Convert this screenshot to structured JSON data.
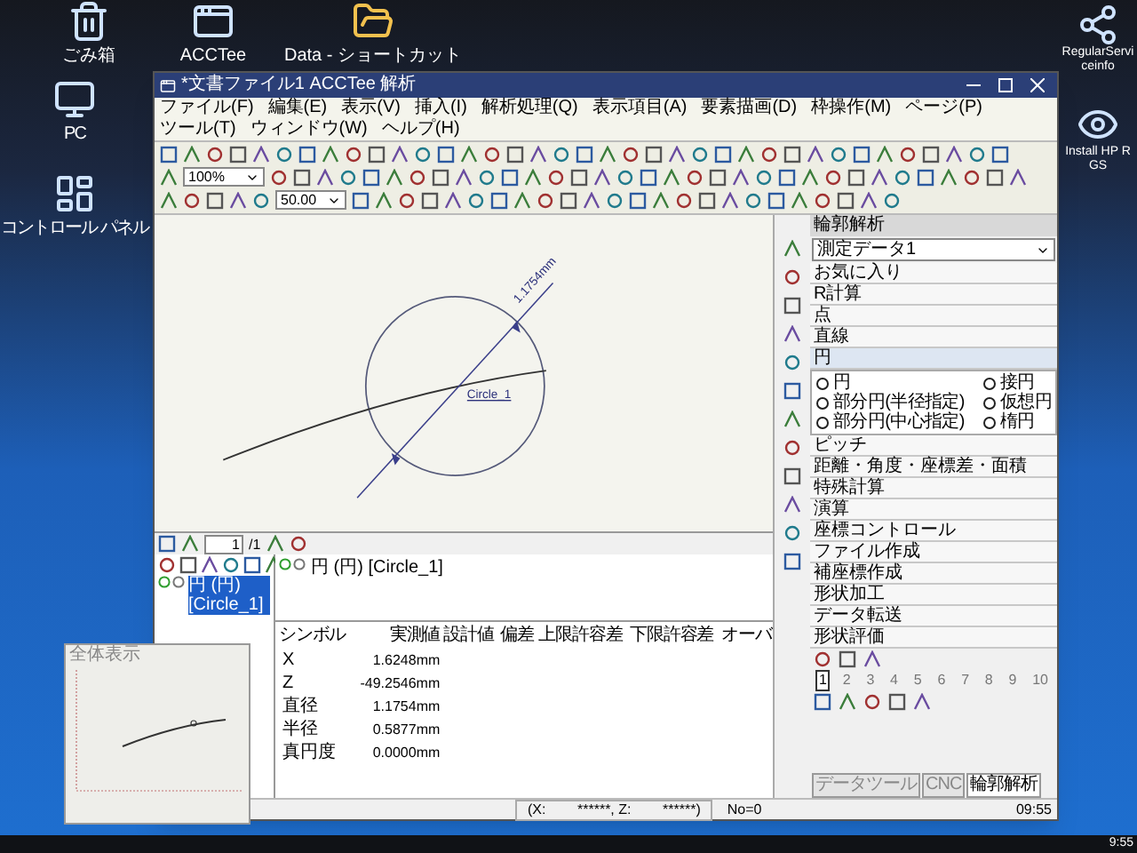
{
  "desktop": {
    "top_icons": [
      {
        "label": "ごみ箱",
        "kind": "trash"
      },
      {
        "label": "ACCTee",
        "kind": "app"
      },
      {
        "label": "Data - ショートカット",
        "kind": "folder"
      }
    ],
    "left_icons": [
      {
        "label": "PC",
        "kind": "pc"
      },
      {
        "label": "コントロール パネル",
        "kind": "control"
      }
    ],
    "right_icons": [
      {
        "label": "RegularServiceinfo",
        "kind": "network"
      },
      {
        "label": "Install HP RGS",
        "kind": "eye"
      }
    ]
  },
  "window": {
    "title": "*文書ファイル1 ACCTee 解析",
    "menu": [
      "ファイル(F)",
      "編集(E)",
      "表示(V)",
      "挿入(I)",
      "解析処理(Q)",
      "表示項目(A)",
      "要素描画(D)",
      "枠操作(M)",
      "ページ(P)",
      "ツール(T)",
      "ウィンドウ(W)",
      "ヘルプ(H)"
    ],
    "zoom_combo": "100%",
    "scale_combo": "50.00",
    "canvas": {
      "dimension_label": "1.1754mm",
      "element_label": "Circle_1"
    },
    "nav": {
      "page": "1",
      "total": "/1"
    },
    "tree": [
      {
        "label": "円 (円) [Circle_1]",
        "selected": true
      }
    ],
    "detail": {
      "header": "円 (円) [Circle_1]",
      "columns": [
        "シンボル",
        "実測値",
        "設計値",
        "偏差",
        "上限許容差",
        "下限許容差",
        "オーバ"
      ],
      "rows": [
        [
          "X",
          "1.6248mm"
        ],
        [
          "Z",
          "-49.2546mm"
        ],
        [
          "直径",
          "1.1754mm"
        ],
        [
          "半径",
          "0.5877mm"
        ],
        [
          "真円度",
          "0.0000mm"
        ]
      ]
    },
    "side_panel": {
      "title": "輪郭解析",
      "data_combo": "測定データ1",
      "items": [
        {
          "label": "お気に入り",
          "expanded": false
        },
        {
          "label": "R計算",
          "expanded": false
        },
        {
          "label": "点",
          "expanded": false
        },
        {
          "label": "直線",
          "expanded": false
        },
        {
          "label": "円",
          "expanded": true,
          "options": [
            "円",
            "接円",
            "部分円(半径指定)",
            "仮想円",
            "部分円(中心指定)",
            "楕円"
          ]
        },
        {
          "label": "ピッチ",
          "expanded": false
        },
        {
          "label": "距離・角度・座標差・面積",
          "expanded": false
        },
        {
          "label": "特殊計算",
          "expanded": false
        },
        {
          "label": "演算",
          "expanded": false
        },
        {
          "label": "座標コントロール",
          "expanded": false
        },
        {
          "label": "ファイル作成",
          "expanded": false
        },
        {
          "label": "補座標作成",
          "expanded": false
        },
        {
          "label": "形状加工",
          "expanded": false
        },
        {
          "label": "データ転送",
          "expanded": false
        },
        {
          "label": "形状評価",
          "expanded": false
        }
      ],
      "pages": [
        {
          "label": "1",
          "selected": true
        },
        {
          "label": "2",
          "selected": false
        },
        {
          "label": "3",
          "selected": false
        },
        {
          "label": "4",
          "selected": false
        },
        {
          "label": "5",
          "selected": false
        },
        {
          "label": "6",
          "selected": false
        },
        {
          "label": "7",
          "selected": false
        },
        {
          "label": "8",
          "selected": false
        },
        {
          "label": "9",
          "selected": false
        },
        {
          "label": "10",
          "selected": false
        }
      ],
      "tabs": [
        {
          "label": "データツール",
          "selected": false
        },
        {
          "label": "CNC",
          "selected": false
        },
        {
          "label": "輪郭解析",
          "selected": true
        }
      ]
    },
    "status_bar": {
      "coordinates": "(X:        ******, Z:        ******)",
      "count": "No=0",
      "time": "09:55"
    }
  },
  "overview": {
    "title": "全体表示"
  },
  "taskbar": {
    "clock": "9:55"
  }
}
